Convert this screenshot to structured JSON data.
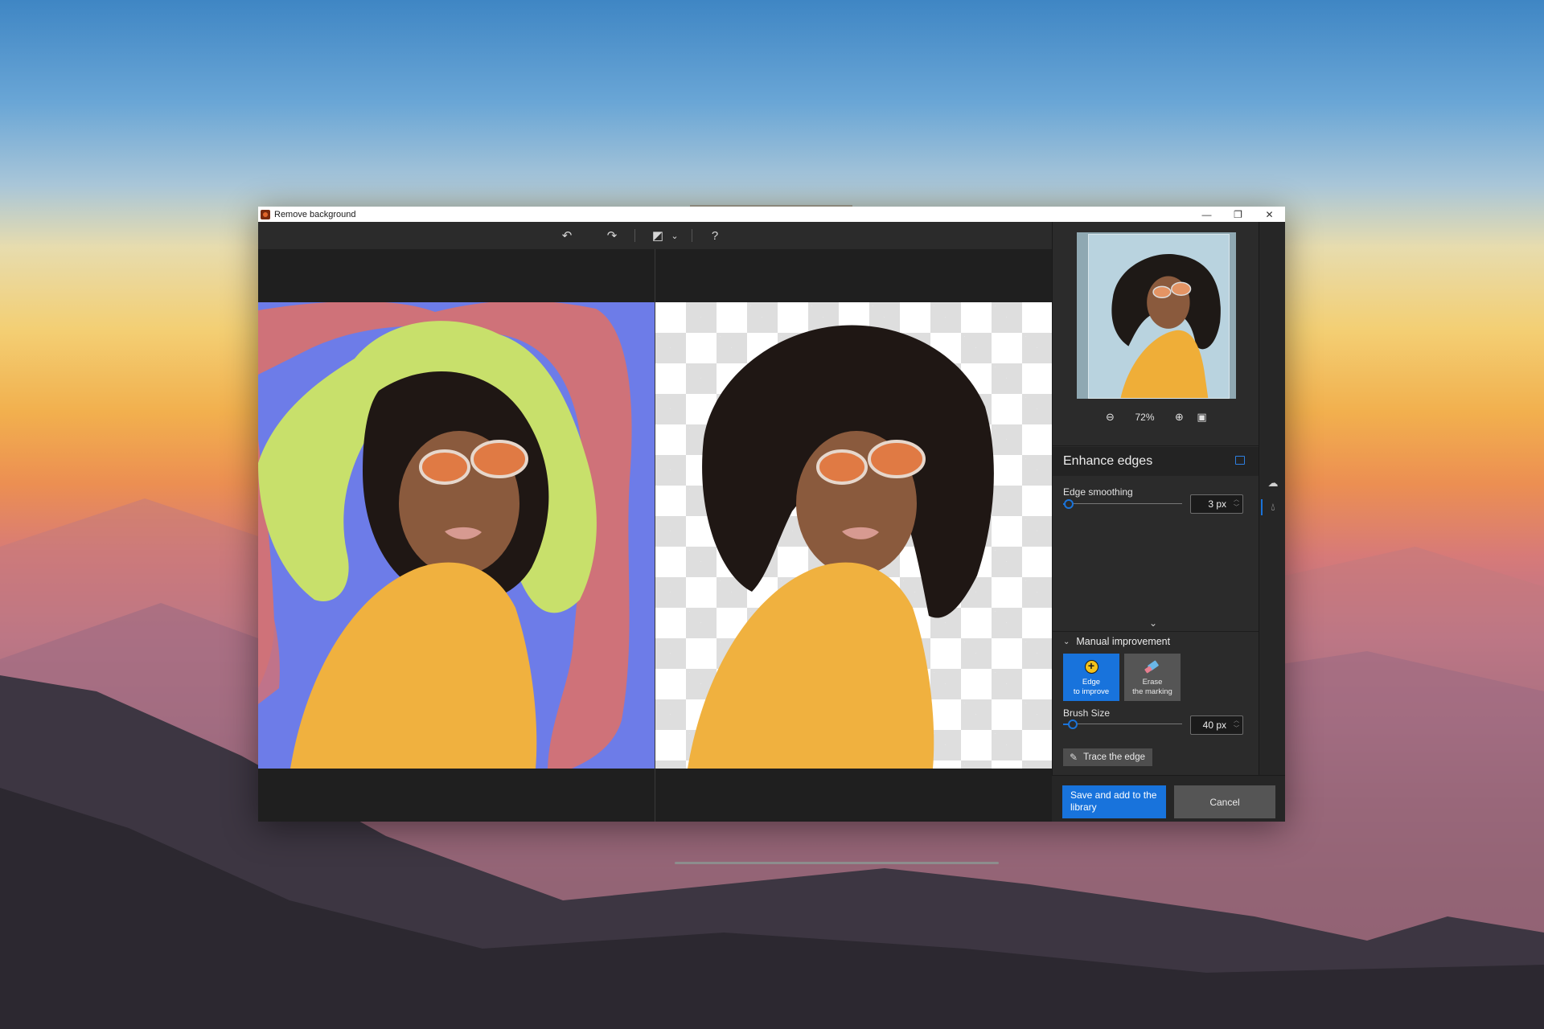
{
  "window": {
    "title": "Remove background",
    "controls": {
      "minimize": "—",
      "maximize": "❐",
      "close": "✕"
    }
  },
  "toolbar": {
    "undo_icon": "↶",
    "redo_icon": "↷",
    "compare_icon": "◩",
    "compare_dropdown": "⌄",
    "help_icon": "?"
  },
  "preview": {
    "zoom_out_icon": "⊖",
    "zoom_value": "72%",
    "zoom_in_icon": "⊕",
    "fit_icon": "▣"
  },
  "enhance_edges": {
    "title": "Enhance edges",
    "edge_smoothing": {
      "label": "Edge smoothing",
      "value": "3 px",
      "slider_fraction": 0.05
    },
    "expand_icon": "⌄"
  },
  "manual_improvement": {
    "title": "Manual improvement",
    "chevron": "⌄",
    "tools": [
      {
        "label_line1": "Edge",
        "label_line2": "to improve",
        "icon": "plus-circle",
        "active": true
      },
      {
        "label_line1": "Erase",
        "label_line2": "the marking",
        "icon": "eraser",
        "active": false
      }
    ],
    "brush_size": {
      "label": "Brush Size",
      "value": "40 px",
      "slider_fraction": 0.08
    },
    "trace_button": "Trace the edge",
    "trace_icon": "✎"
  },
  "rail": {
    "icons": [
      "cloud-sync",
      "droplet"
    ]
  },
  "footer": {
    "save_label": "Save and add to the library",
    "cancel_label": "Cancel"
  },
  "colors": {
    "accent": "#1873dc",
    "keep_marker": "#c8e06b",
    "remove_marker": "#cf7279",
    "background_mask": "#6d7ce8"
  }
}
